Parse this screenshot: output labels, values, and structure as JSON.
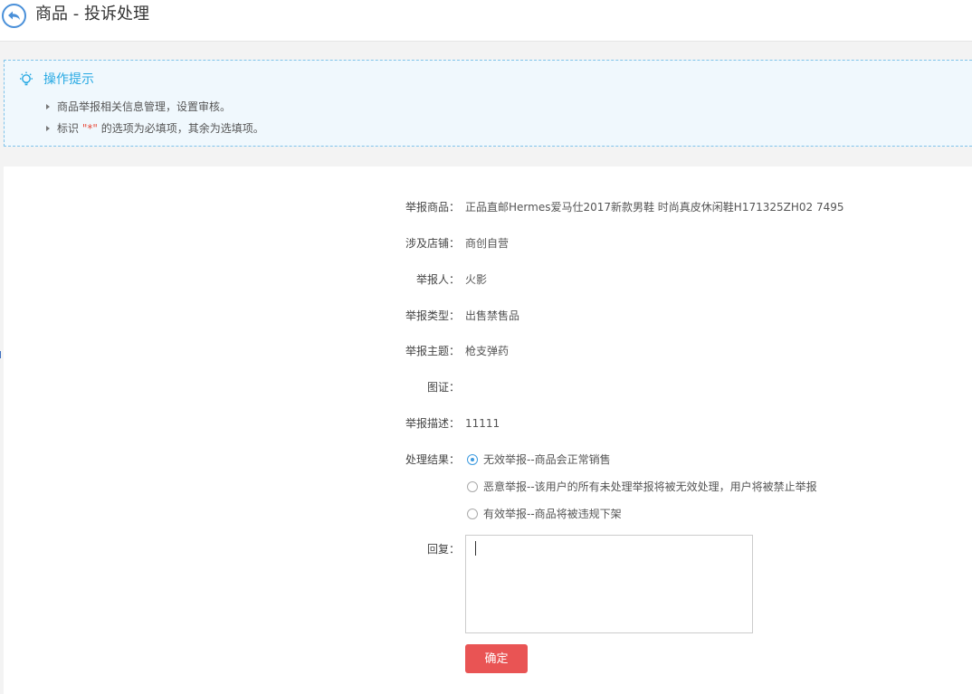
{
  "header": {
    "title": "商品 - 投诉处理"
  },
  "tips": {
    "title": "操作提示",
    "items": [
      "商品举报相关信息管理，设置审核。",
      "标识"
    ],
    "required_note_pre": "标识 ",
    "required_mark": "\"*\"",
    "required_note_post": " 的选项为必填项，其余为选填项。"
  },
  "form": {
    "product_label": "举报商品：",
    "product_value": "正品直邮Hermes爱马仕2017新款男鞋 时尚真皮休闲鞋H171325ZH02 7495",
    "store_label": "涉及店铺：",
    "store_value": "商创自营",
    "reporter_label": "举报人：",
    "reporter_value": "火影",
    "type_label": "举报类型：",
    "type_value": "出售禁售品",
    "subject_label": "举报主题：",
    "subject_value": "枪支弹药",
    "evidence_label": "图证：",
    "desc_label": "举报描述：",
    "desc_value": "11111",
    "result_label": "处理结果：",
    "result_options": [
      "无效举报--商品会正常销售",
      "恶意举报--该用户的所有未处理举报将被无效处理，用户将被禁止举报",
      "有效举报--商品将被违规下架"
    ],
    "result_selected": 0,
    "reply_label": "回复：",
    "reply_value": "",
    "submit_label": "确定"
  },
  "colors": {
    "accent": "#27a9e3",
    "submit": "#e95454",
    "radio_selected": "#3e9be0"
  }
}
